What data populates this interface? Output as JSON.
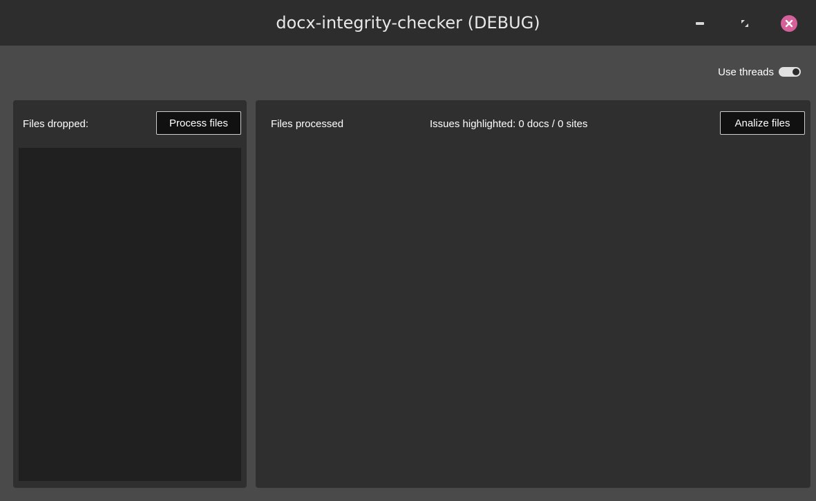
{
  "window": {
    "title": "docx-integrity-checker (DEBUG)",
    "colors": {
      "close_button": "#d5609a",
      "titlebar": "#2d2d2d",
      "background": "#4a4a4a"
    }
  },
  "toolbar": {
    "use_threads_label": "Use threads",
    "use_threads_enabled": true
  },
  "left_panel": {
    "label": "Files dropped:",
    "process_button": "Process files"
  },
  "right_panel": {
    "label": "Files processed",
    "issues_text": "Issues highlighted: 0 docs / 0 sites",
    "analyze_button": "Analize files"
  },
  "icons": {
    "minimize": "minimize-icon",
    "maximize": "maximize-icon",
    "close": "close-icon"
  }
}
